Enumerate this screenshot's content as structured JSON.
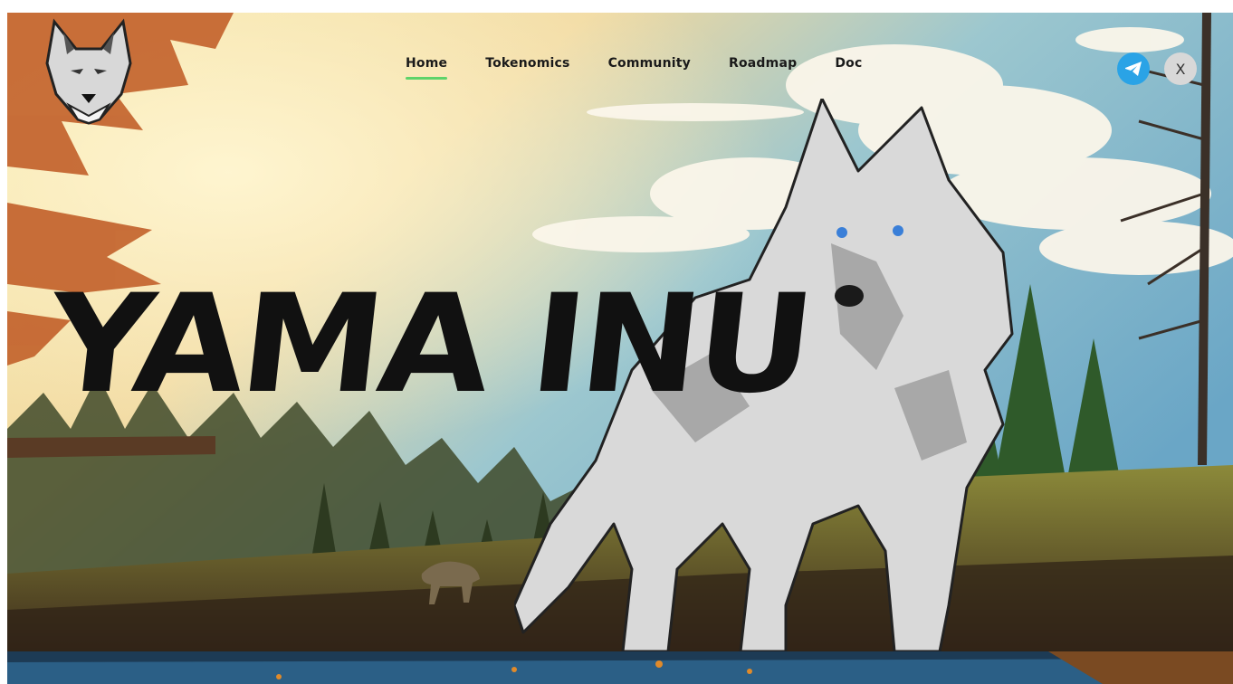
{
  "header": {
    "logo_icon": "wolf-head-logo-icon",
    "nav": [
      {
        "label": "Home",
        "active": true
      },
      {
        "label": "Tokenomics",
        "active": false
      },
      {
        "label": "Community",
        "active": false
      },
      {
        "label": "Roadmap",
        "active": false
      },
      {
        "label": "Doc",
        "active": false
      }
    ],
    "social": {
      "telegram_icon": "telegram-icon",
      "x_icon": "x-icon",
      "x_label": "X"
    }
  },
  "hero": {
    "title": "YAMA INU"
  },
  "colors": {
    "active_underline": "#5dd36a",
    "telegram": "#2aa3e6",
    "title": "#111111"
  }
}
